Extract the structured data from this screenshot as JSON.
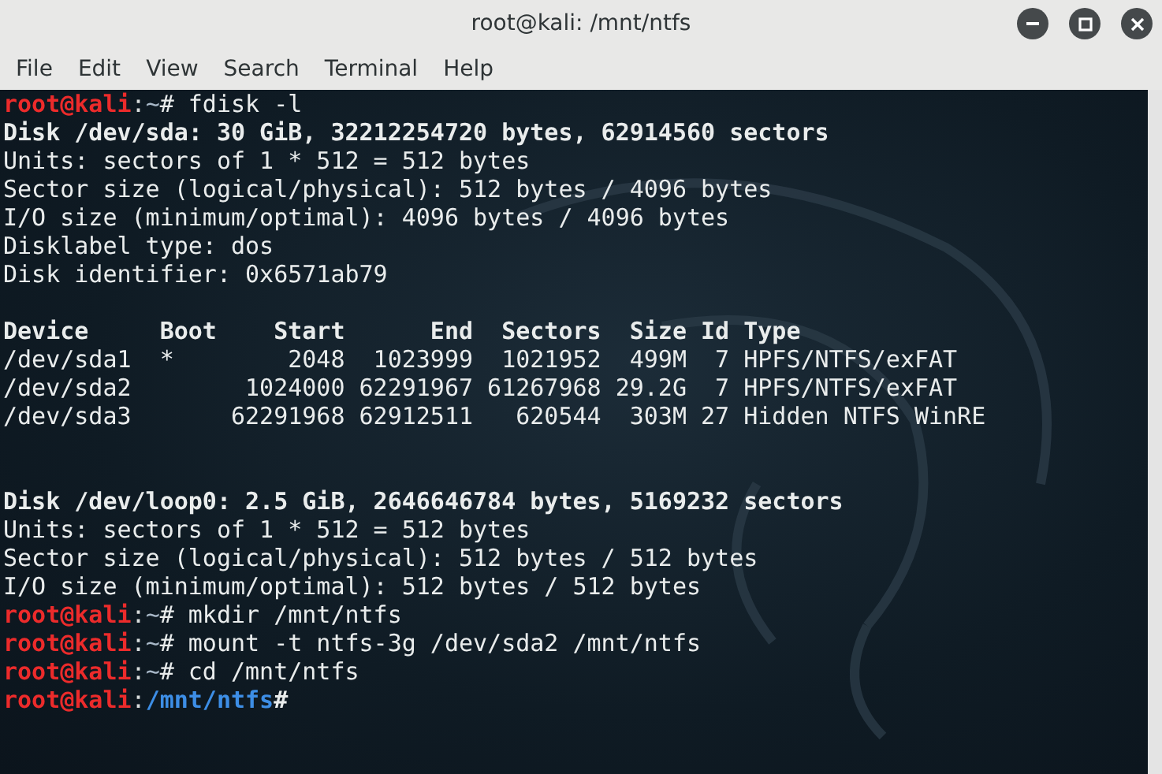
{
  "window": {
    "title": "root@kali: /mnt/ntfs"
  },
  "menu": [
    "File",
    "Edit",
    "View",
    "Search",
    "Terminal",
    "Help"
  ],
  "lines": [
    {
      "kind": "prompt",
      "user": "root@kali",
      "sep": ":",
      "path": "~",
      "mark": "#",
      "command": " fdisk -l"
    },
    {
      "kind": "bold",
      "text": "Disk /dev/sda: 30 GiB, 32212254720 bytes, 62914560 sectors"
    },
    {
      "kind": "plain",
      "text": "Units: sectors of 1 * 512 = 512 bytes"
    },
    {
      "kind": "plain",
      "text": "Sector size (logical/physical): 512 bytes / 4096 bytes"
    },
    {
      "kind": "plain",
      "text": "I/O size (minimum/optimal): 4096 bytes / 4096 bytes"
    },
    {
      "kind": "plain",
      "text": "Disklabel type: dos"
    },
    {
      "kind": "plain",
      "text": "Disk identifier: 0x6571ab79"
    },
    {
      "kind": "blank"
    },
    {
      "kind": "bold",
      "text": "Device     Boot    Start      End  Sectors  Size Id Type"
    },
    {
      "kind": "plain",
      "text": "/dev/sda1  *        2048  1023999  1021952  499M  7 HPFS/NTFS/exFAT"
    },
    {
      "kind": "plain",
      "text": "/dev/sda2        1024000 62291967 61267968 29.2G  7 HPFS/NTFS/exFAT"
    },
    {
      "kind": "plain",
      "text": "/dev/sda3       62291968 62912511   620544  303M 27 Hidden NTFS WinRE"
    },
    {
      "kind": "blank"
    },
    {
      "kind": "blank"
    },
    {
      "kind": "bold",
      "text": "Disk /dev/loop0: 2.5 GiB, 2646646784 bytes, 5169232 sectors"
    },
    {
      "kind": "plain",
      "text": "Units: sectors of 1 * 512 = 512 bytes"
    },
    {
      "kind": "plain",
      "text": "Sector size (logical/physical): 512 bytes / 512 bytes"
    },
    {
      "kind": "plain",
      "text": "I/O size (minimum/optimal): 512 bytes / 512 bytes"
    },
    {
      "kind": "prompt",
      "user": "root@kali",
      "sep": ":",
      "path": "~",
      "mark": "#",
      "command": " mkdir /mnt/ntfs"
    },
    {
      "kind": "prompt",
      "user": "root@kali",
      "sep": ":",
      "path": "~",
      "mark": "#",
      "command": " mount -t ntfs-3g /dev/sda2 /mnt/ntfs"
    },
    {
      "kind": "prompt",
      "user": "root@kali",
      "sep": ":",
      "path": "~",
      "mark": "#",
      "command": " cd /mnt/ntfs"
    },
    {
      "kind": "prompt",
      "user": "root@kali",
      "sep": ":",
      "path": "/mnt/ntfs",
      "mark": "#",
      "bold_path": true
    }
  ]
}
